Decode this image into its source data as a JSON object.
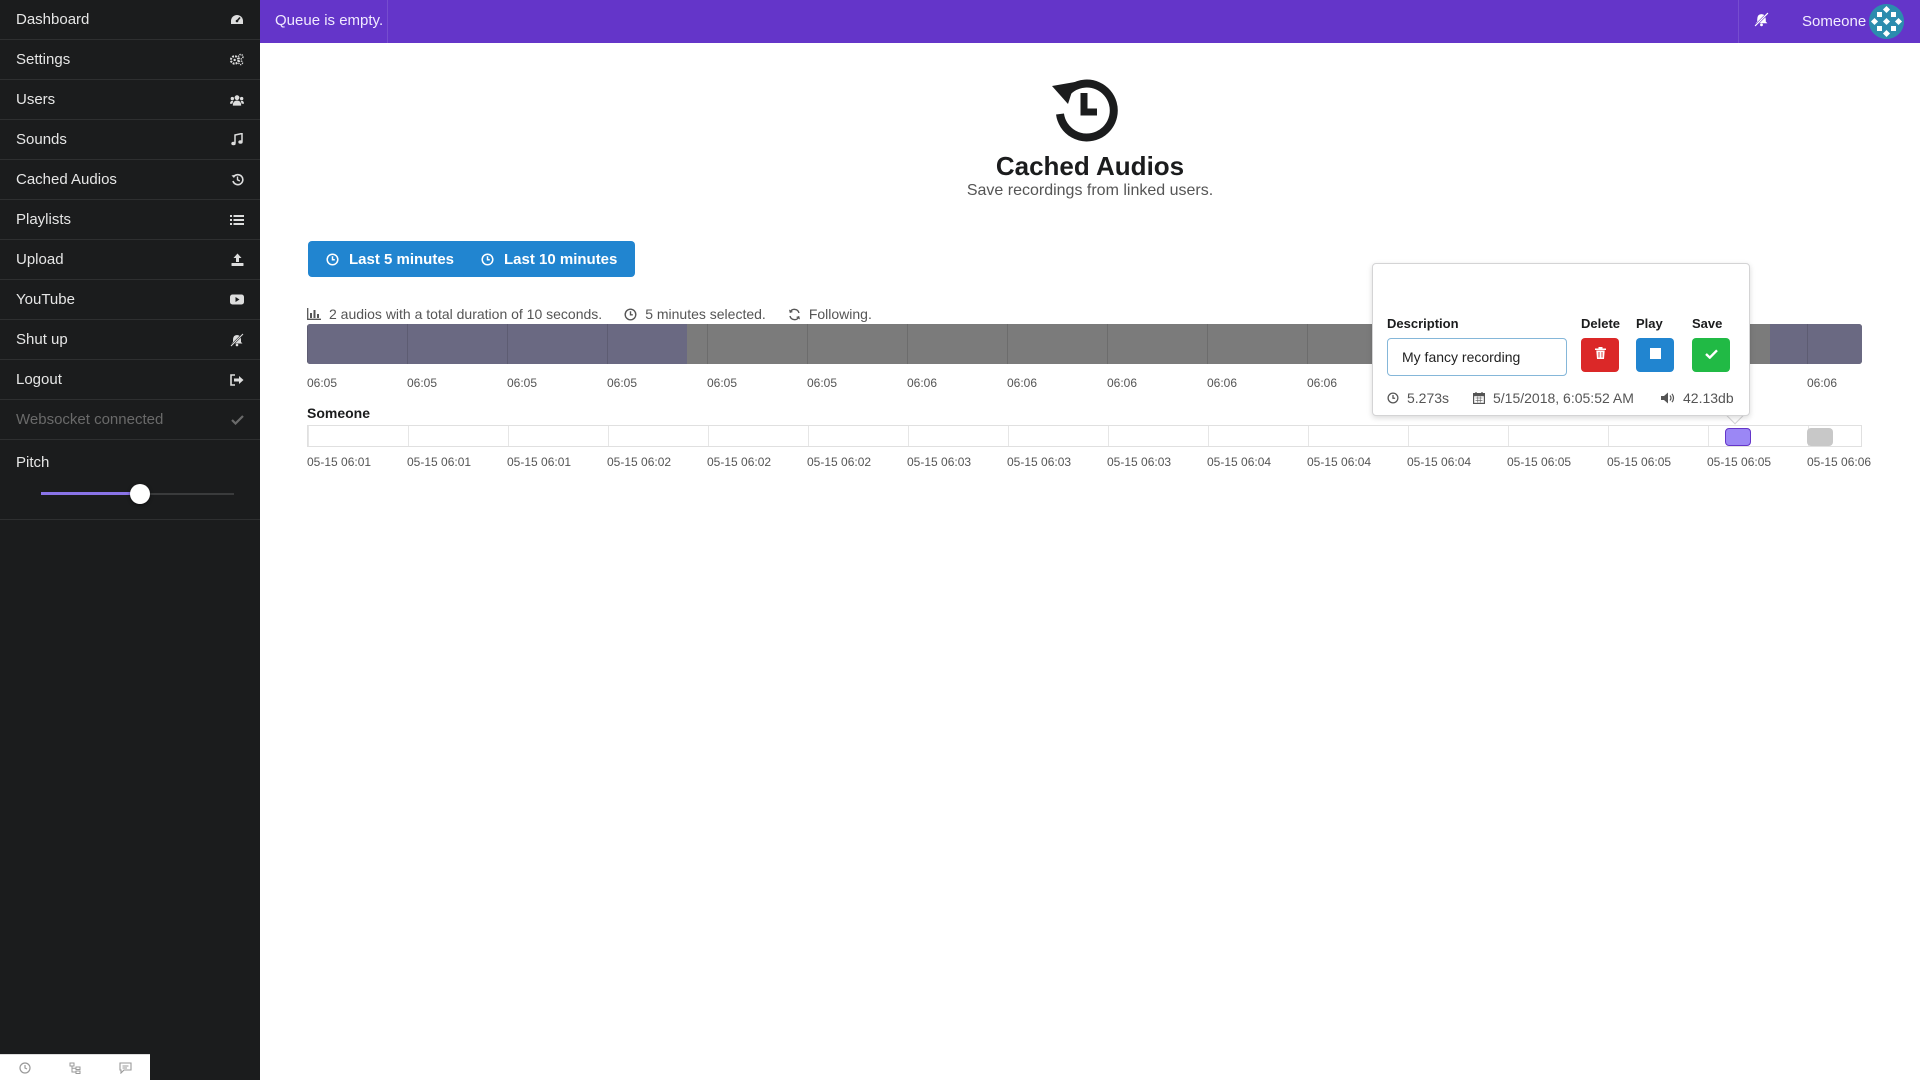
{
  "sidebar": {
    "items": [
      {
        "label": "Dashboard",
        "icon": "dashboard-icon"
      },
      {
        "label": "Settings",
        "icon": "cogs-icon"
      },
      {
        "label": "Users",
        "icon": "users-icon"
      },
      {
        "label": "Sounds",
        "icon": "music-icon"
      },
      {
        "label": "Cached Audios",
        "icon": "history-icon"
      },
      {
        "label": "Playlists",
        "icon": "list-icon"
      },
      {
        "label": "Upload",
        "icon": "upload-icon"
      },
      {
        "label": "YouTube",
        "icon": "youtube-icon"
      },
      {
        "label": "Shut up",
        "icon": "mute-icon"
      },
      {
        "label": "Logout",
        "icon": "sign-out-icon"
      },
      {
        "label": "Websocket connected",
        "icon": "check-icon",
        "disabled": true
      }
    ],
    "pitch": {
      "label": "Pitch",
      "value": 0.5
    }
  },
  "topbar": {
    "queue_text": "Queue is empty.",
    "user_name": "Someone"
  },
  "page": {
    "title": "Cached Audios",
    "subtitle": "Save recordings from linked users."
  },
  "buttons": {
    "last5": "Last 5 minutes",
    "last10": "Last 10 minutes"
  },
  "info": {
    "audios": "2 audios with a total duration of 10 seconds.",
    "selected": "5 minutes selected.",
    "following": "Following."
  },
  "overview": {
    "tick_labels": [
      "06:05",
      "06:05",
      "06:05",
      "06:05",
      "06:05",
      "06:05",
      "06:06",
      "06:06",
      "06:06",
      "06:06",
      "06:06",
      "06:06",
      "06:06",
      "06:06",
      "06:06",
      "06:06"
    ]
  },
  "timeline": {
    "user": "Someone",
    "tick_labels": [
      "05-15 06:01",
      "05-15 06:01",
      "05-15 06:01",
      "05-15 06:02",
      "05-15 06:02",
      "05-15 06:02",
      "05-15 06:03",
      "05-15 06:03",
      "05-15 06:03",
      "05-15 06:04",
      "05-15 06:04",
      "05-15 06:04",
      "05-15 06:05",
      "05-15 06:05",
      "05-15 06:05",
      "05-15 06:06"
    ]
  },
  "popup": {
    "description_label": "Description",
    "description_value": "My fancy recording",
    "delete_label": "Delete",
    "play_label": "Play",
    "save_label": "Save",
    "duration": "5.273s",
    "date": "5/15/2018, 6:05:52 AM",
    "volume": "42.13db"
  },
  "colors": {
    "accent": "#6435c9",
    "primary": "#2185d0",
    "danger": "#db2828",
    "success": "#21ba45",
    "selected_audio": "#9b87f5"
  }
}
